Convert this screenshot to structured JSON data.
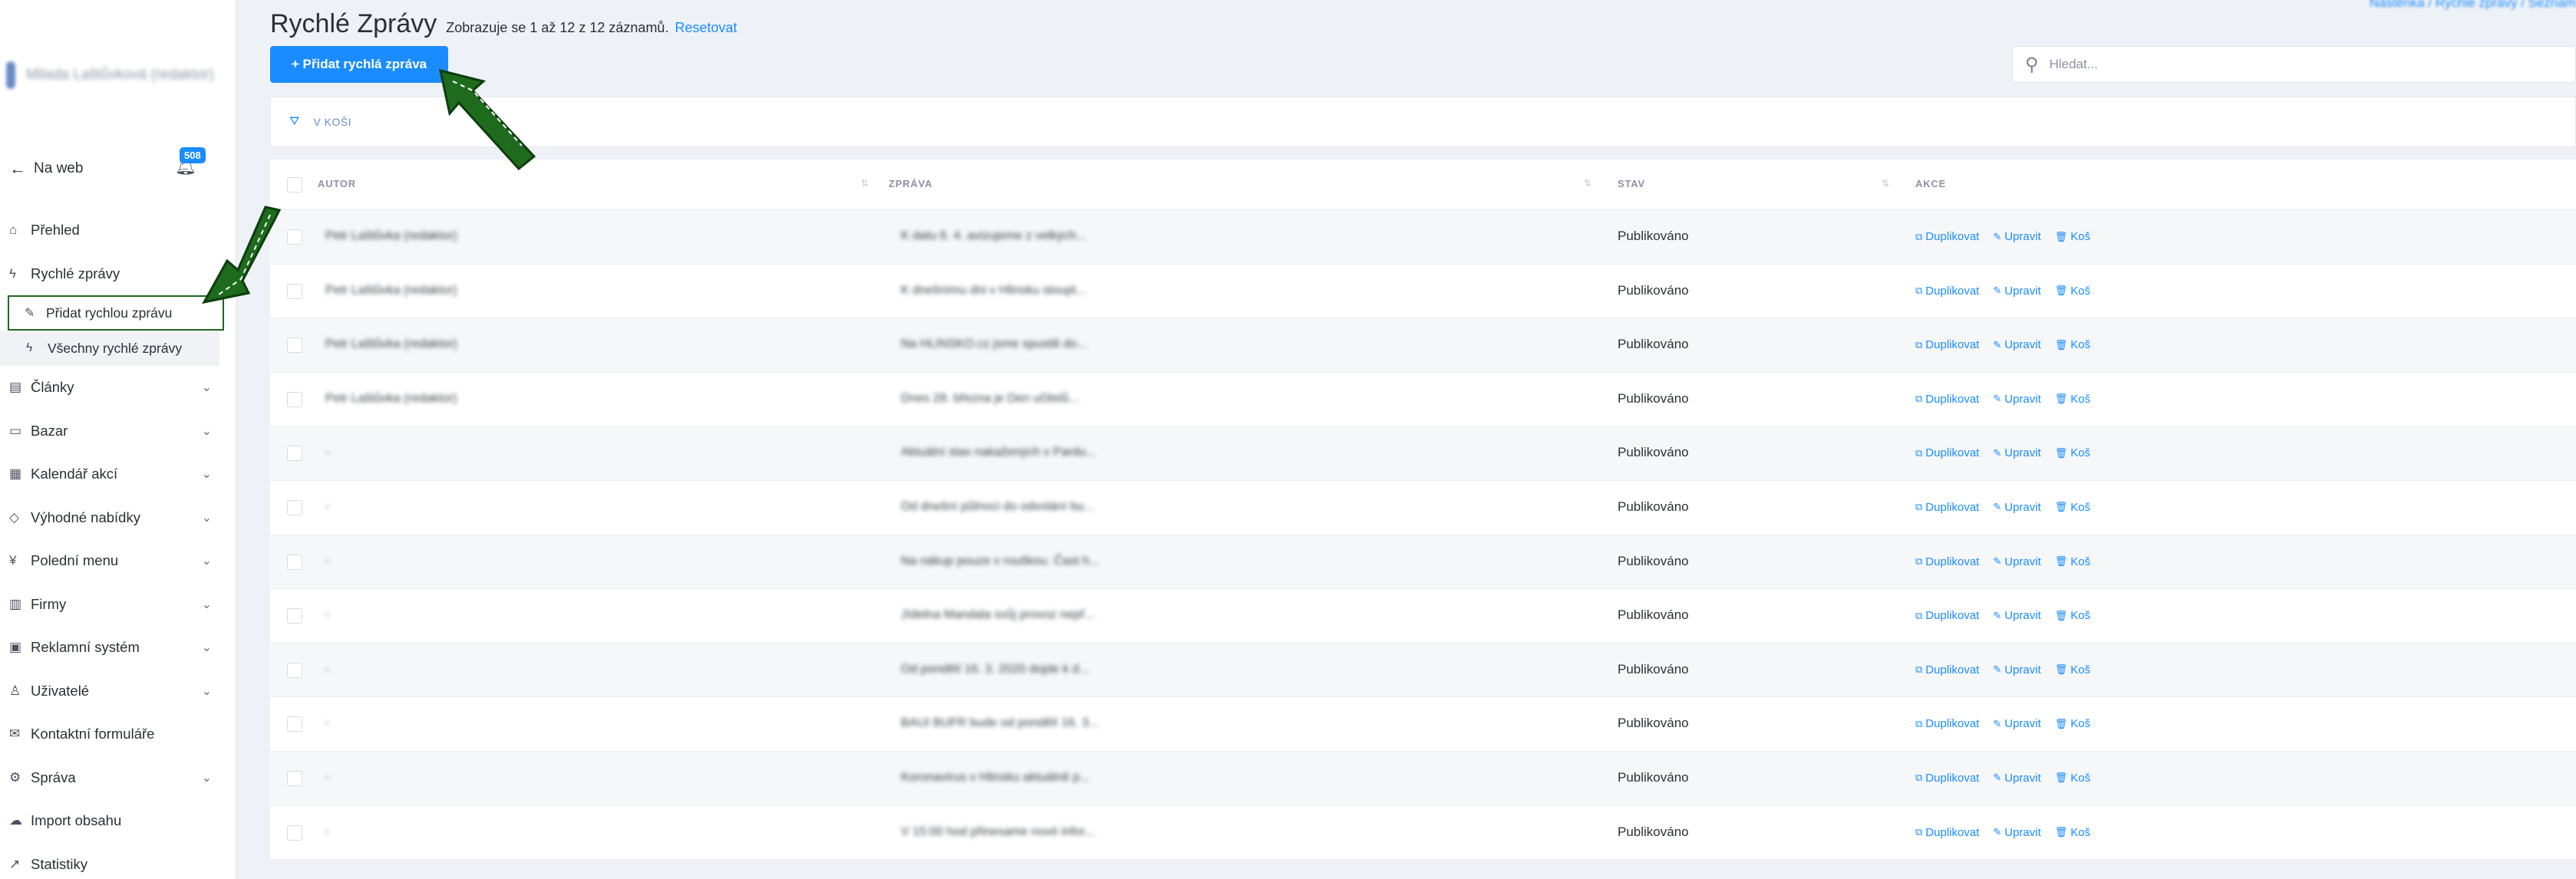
{
  "sidebar": {
    "user_name": "Milada Laštůvková (redaktor)",
    "back_to_web": "Na web",
    "notifications_count": "508",
    "menu": [
      {
        "label": "Přehled",
        "icon": "home-icon",
        "has_children": false
      },
      {
        "label": "Rychlé zprávy",
        "icon": "bolt-icon",
        "has_children": false,
        "children": [
          {
            "label": "Přidat rychlou zprávu",
            "icon": "edit-icon",
            "active": true
          },
          {
            "label": "Všechny rychlé zprávy",
            "icon": "bolt-icon",
            "active": false
          }
        ]
      },
      {
        "label": "Články",
        "icon": "newspaper-icon",
        "has_children": true
      },
      {
        "label": "Bazar",
        "icon": "store-icon",
        "has_children": true
      },
      {
        "label": "Kalendář akcí",
        "icon": "calendar-icon",
        "has_children": true
      },
      {
        "label": "Výhodné nabídky",
        "icon": "tag-icon",
        "has_children": true
      },
      {
        "label": "Polední menu",
        "icon": "utensils-icon",
        "has_children": true
      },
      {
        "label": "Firmy",
        "icon": "building-icon",
        "has_children": true
      },
      {
        "label": "Reklamní systém",
        "icon": "ad-icon",
        "has_children": true
      },
      {
        "label": "Uživatelé",
        "icon": "user-icon",
        "has_children": true
      },
      {
        "label": "Kontaktní formuláře",
        "icon": "envelope-icon",
        "has_children": false
      },
      {
        "label": "Správa",
        "icon": "gear-icon",
        "has_children": true
      },
      {
        "label": "Import obsahu",
        "icon": "cloud-icon",
        "has_children": false
      },
      {
        "label": "Statistiky",
        "icon": "chart-icon",
        "has_children": false
      }
    ]
  },
  "header": {
    "title": "Rychlé Zprávy",
    "count_text": "Zobrazuje se 1 až 12 z 12 záznamů.",
    "reset_label": "Resetovat",
    "breadcrumb": "Nástěnka / Rychlé zprávy / Seznam"
  },
  "toolbar": {
    "add_label": "+ Přidat rychlá zpráva",
    "search_placeholder": "Hledat..."
  },
  "filter": {
    "label": "V KOŠI"
  },
  "table": {
    "columns": [
      "AUTOR",
      "ZPRÁVA",
      "STAV",
      "AKCE"
    ],
    "action_labels": {
      "duplicate": "Duplikovat",
      "edit": "Upravit",
      "trash": "Koš"
    },
    "rows": [
      {
        "author": "Petr Laštůvka (redaktor)",
        "message": "K datu 6. 4. avizujeme z velkých...",
        "status": "Publikováno"
      },
      {
        "author": "Petr Laštůvka (redaktor)",
        "message": "K dnešnímu dni v Hlinsku stoupl...",
        "status": "Publikováno"
      },
      {
        "author": "Petr Laštůvka (redaktor)",
        "message": "Na HLINSKO.cz jsme spustili do...",
        "status": "Publikováno"
      },
      {
        "author": "Petr Laštůvka (redaktor)",
        "message": "Dnes 28. března je Den učitelů...",
        "status": "Publikováno"
      },
      {
        "author": "-",
        "message": "Aktuální stav nakažených v Pardu...",
        "status": "Publikováno"
      },
      {
        "author": "-",
        "message": "Od dnešní půlnoci do odvolání bu...",
        "status": "Publikováno"
      },
      {
        "author": "-",
        "message": "Na nákup pouze v rouškou. Čast h...",
        "status": "Publikováno"
      },
      {
        "author": "-",
        "message": "Jídelna Mandala svůj provoz nepř...",
        "status": "Publikováno"
      },
      {
        "author": "-",
        "message": "Od pondělí 16. 3. 2020 dojde k d...",
        "status": "Publikováno"
      },
      {
        "author": "-",
        "message": "BAUI BUFR bude od pondělí 16. 3...",
        "status": "Publikováno"
      },
      {
        "author": "-",
        "message": "Koronavirus v Hlinsku aktuálně p...",
        "status": "Publikováno"
      },
      {
        "author": "-",
        "message": "V 15:00 hod přinesame nové infor...",
        "status": "Publikováno"
      }
    ]
  },
  "colors": {
    "accent": "#1a8cff",
    "annotation": "#1e6b1e"
  }
}
